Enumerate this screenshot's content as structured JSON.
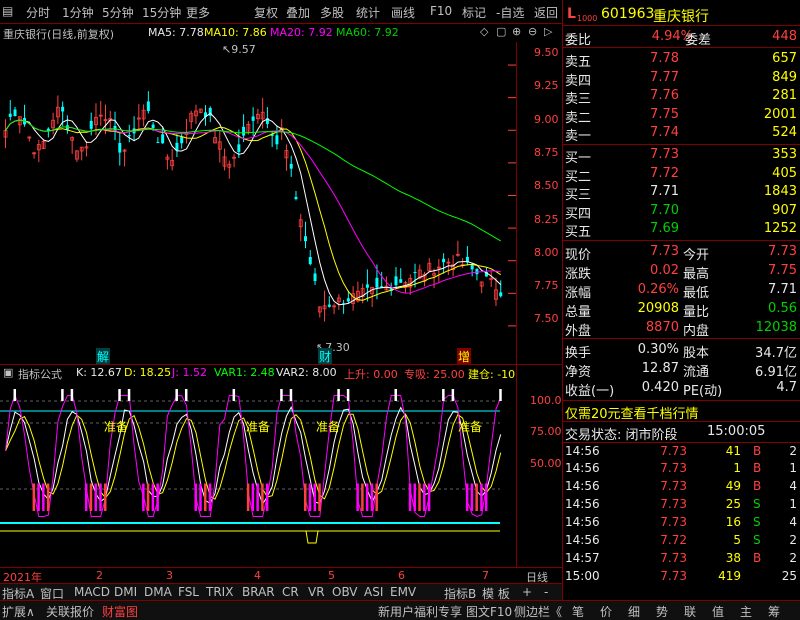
{
  "toolbar": {
    "left": [
      "分时",
      "1分钟",
      "5分钟",
      "15分钟",
      "更多"
    ],
    "right": [
      "复权",
      "叠加",
      "多股",
      "统计",
      "画线",
      "F10",
      "标记",
      "-自选",
      "返回"
    ]
  },
  "chart_title": {
    "name": "重庆银行(日线,前复权)",
    "ma5": "MA5: 7.78",
    "ma10": "MA10: 7.86",
    "ma20": "MA20: 7.92",
    "ma60": "MA60: 7.92"
  },
  "price_axis": [
    "9.50",
    "9.25",
    "9.00",
    "8.75",
    "8.50",
    "8.25",
    "8.00",
    "7.75",
    "7.50"
  ],
  "annotations": {
    "high": "9.57",
    "low": "7.30",
    "tag1": "解",
    "tag2": "财",
    "tag3": "增"
  },
  "indicator_title": {
    "name": "指标公式",
    "k": "K: 12.67",
    "d": "D: 18.25",
    "j": "J: 1.52",
    "var1": "VAR1: 2.48",
    "var2": "VAR2: 8.00",
    "up": "上升: 0.00",
    "absorb": "专吸: 25.00",
    "build": "建仓: -10"
  },
  "ind_axis": [
    "100.0",
    "75.00",
    "50.00"
  ],
  "ind_labels": [
    "准备",
    "准备",
    "准备",
    "准备"
  ],
  "time_axis": [
    "2021年",
    "2",
    "3",
    "4",
    "5",
    "6",
    "7"
  ],
  "time_axis_right": "日线",
  "tabs": [
    "指标A",
    "窗口",
    "MACD",
    "DMI",
    "DMA",
    "FSL",
    "TRIX",
    "BRAR",
    "CR",
    "VR",
    "OBV",
    "ASI",
    "EMV"
  ],
  "tabs_right": [
    "指标B",
    "模 板",
    "+",
    "-"
  ],
  "bottom_left": [
    "扩展",
    "关联报价",
    "财富图"
  ],
  "bottom_mid": [
    "新用户福利专享",
    "图文F10",
    "侧边栏"
  ],
  "bottom_right": [
    "笔",
    "价",
    "细",
    "势",
    "联",
    "值",
    "主",
    "筹"
  ],
  "stock": {
    "code": "601963",
    "name": "重庆银行",
    "webi_label": "委比",
    "webi_value": "4.94%",
    "weicha_label": "委差",
    "weicha_value": "448",
    "asks": [
      {
        "label": "卖五",
        "price": "7.78",
        "vol": "657"
      },
      {
        "label": "卖四",
        "price": "7.77",
        "vol": "849"
      },
      {
        "label": "卖三",
        "price": "7.76",
        "vol": "281"
      },
      {
        "label": "卖二",
        "price": "7.75",
        "vol": "2001"
      },
      {
        "label": "卖一",
        "price": "7.74",
        "vol": "524"
      }
    ],
    "bids": [
      {
        "label": "买一",
        "price": "7.73",
        "vol": "353"
      },
      {
        "label": "买二",
        "price": "7.72",
        "vol": "405"
      },
      {
        "label": "买三",
        "price": "7.71",
        "vol": "1843"
      },
      {
        "label": "买四",
        "price": "7.70",
        "vol": "907"
      },
      {
        "label": "买五",
        "price": "7.69",
        "vol": "1252"
      }
    ],
    "quote": [
      {
        "l1": "现价",
        "v1": "7.73",
        "l2": "今开",
        "v2": "7.73"
      },
      {
        "l1": "涨跌",
        "v1": "0.02",
        "l2": "最高",
        "v2": "7.75"
      },
      {
        "l1": "涨幅",
        "v1": "0.26%",
        "l2": "最低",
        "v2": "7.71"
      },
      {
        "l1": "总量",
        "v1": "20908",
        "l2": "量比",
        "v2": "0.56"
      },
      {
        "l1": "外盘",
        "v1": "8870",
        "l2": "内盘",
        "v2": "12038"
      }
    ],
    "stats": [
      {
        "l1": "换手",
        "v1": "0.30%",
        "l2": "股本",
        "v2": "34.7亿"
      },
      {
        "l1": "净资",
        "v1": "12.87",
        "l2": "流通",
        "v2": "6.91亿"
      },
      {
        "l1": "收益(一)",
        "v1": "0.420",
        "l2": "PE(动)",
        "v2": "4.7"
      }
    ],
    "promo": "仅需20元查看千档行情",
    "trade_status": "交易状态: 闭市阶段",
    "trade_time": "15:00:05",
    "ticks": [
      {
        "t": "14:56",
        "p": "7.73",
        "v": "41",
        "d": "B",
        "n": "2"
      },
      {
        "t": "14:56",
        "p": "7.73",
        "v": "1",
        "d": "B",
        "n": "1"
      },
      {
        "t": "14:56",
        "p": "7.73",
        "v": "49",
        "d": "B",
        "n": "4"
      },
      {
        "t": "14:56",
        "p": "7.73",
        "v": "25",
        "d": "S",
        "n": "1"
      },
      {
        "t": "14:56",
        "p": "7.73",
        "v": "16",
        "d": "S",
        "n": "4"
      },
      {
        "t": "14:56",
        "p": "7.72",
        "v": "5",
        "d": "S",
        "n": "2"
      },
      {
        "t": "14:57",
        "p": "7.73",
        "v": "38",
        "d": "B",
        "n": "2"
      },
      {
        "t": "15:00",
        "p": "7.73",
        "v": "419",
        "d": "",
        "n": "25"
      }
    ]
  },
  "chart_data": {
    "type": "line",
    "title": "重庆银行(日线,前复权)",
    "ylim": [
      7.3,
      9.6
    ],
    "series": [
      {
        "name": "MA60",
        "values": [
          8.95,
          8.94,
          8.93,
          8.92,
          8.9,
          8.88,
          8.82,
          8.72,
          8.6,
          8.5,
          8.38,
          8.25,
          8.12,
          8.03,
          7.97,
          7.92
        ]
      },
      {
        "name": "MA20",
        "values": [
          9.0,
          8.98,
          8.95,
          9.0,
          8.95,
          8.9,
          8.75,
          8.3,
          7.9,
          7.75,
          7.78,
          7.82,
          7.88,
          7.95,
          7.97,
          7.92
        ]
      }
    ]
  },
  "colors": {
    "up": "#ff4040",
    "down": "#00ffff",
    "ma5": "#ffffff",
    "ma10": "#ffff00",
    "ma20": "#ff00ff",
    "ma60": "#00ff00",
    "frame": "#800000"
  }
}
